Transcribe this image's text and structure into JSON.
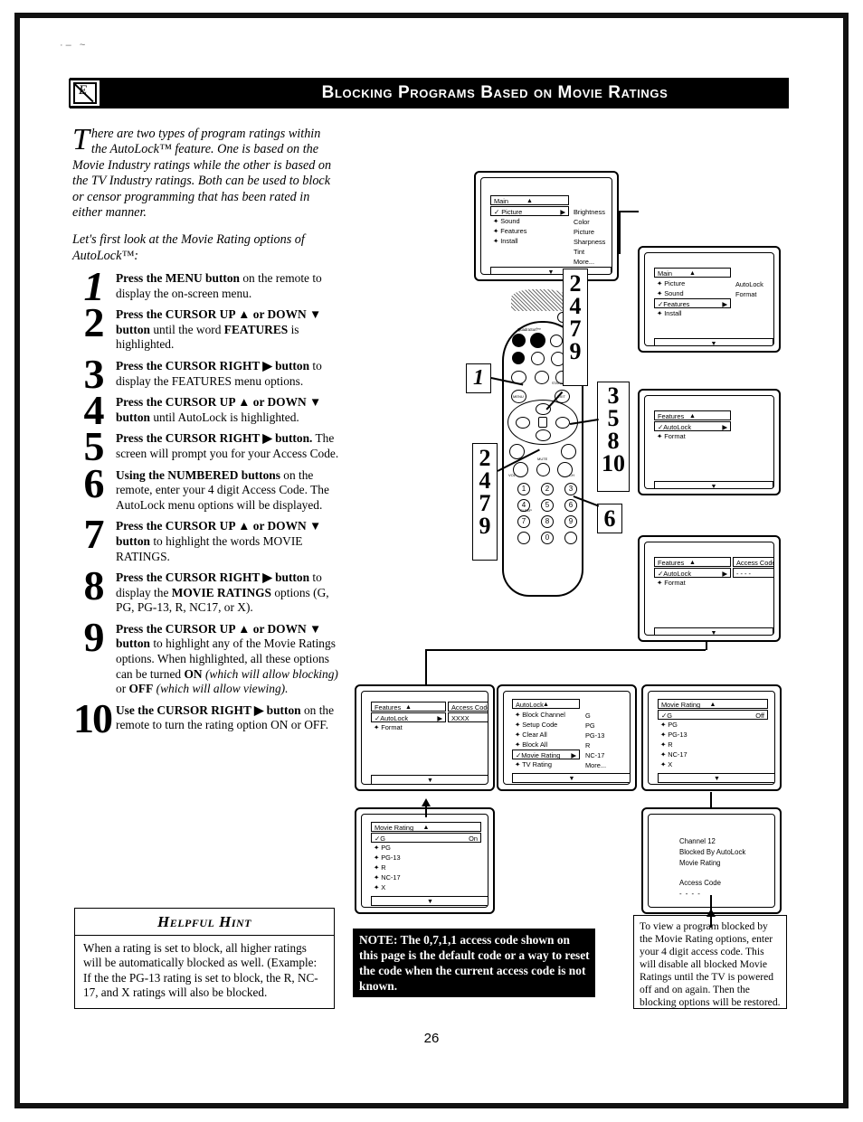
{
  "header": {
    "title": "Blocking Programs Based on Movie Ratings",
    "icon": "no-viewing-icon"
  },
  "intro": {
    "dropcap": "T",
    "paragraph1": "here are two types of program ratings within the AutoLock™ feature. One is based on the Movie Industry ratings while the other is based on the TV Industry ratings. Both can be used to block or censor programming that has been rated in either manner.",
    "paragraph2": "Let's first look at the Movie Rating options of AutoLock™:"
  },
  "steps": [
    {
      "num": "1",
      "html": "<b>Press the MENU button</b> on the remote to display the on-screen menu."
    },
    {
      "num": "2",
      "html": "<b>Press the CURSOR UP ▲ or DOWN ▼ button</b> until the word <b>FEATURES</b> is highlighted."
    },
    {
      "num": "3",
      "html": "<b>Press the CURSOR RIGHT ▶ button</b> to display the FEATURES menu options."
    },
    {
      "num": "4",
      "html": "<b>Press the CURSOR UP ▲ or DOWN ▼ button</b> until AutoLock is highlighted."
    },
    {
      "num": "5",
      "html": "<b>Press the CURSOR RIGHT ▶ button.</b> The screen will prompt you for your Access Code."
    },
    {
      "num": "6",
      "html": "<b>Using the NUMBERED buttons</b> on the remote, enter your 4 digit Access Code. The AutoLock menu options will be displayed."
    },
    {
      "num": "7",
      "html": "<b>Press the CURSOR UP ▲ or DOWN ▼ button</b> to highlight the words MOVIE RATINGS."
    },
    {
      "num": "8",
      "html": "<b>Press the CURSOR RIGHT ▶ button</b> to display the <b>MOVIE RATINGS</b> options (G, PG, PG-13, R, NC17, or X)."
    },
    {
      "num": "9",
      "html": "<b>Press the CURSOR UP ▲ or DOWN ▼ button</b> to highlight any of the Movie Ratings options. When highlighted, all these options can be turned <b>ON</b> <i>(which will allow blocking)</i> or <b>OFF</b> <i>(which will allow viewing).</i>"
    },
    {
      "num": "10",
      "html": "<b>Use the CURSOR RIGHT ▶ button</b> on the remote to turn the rating option ON or OFF."
    }
  ],
  "hint": {
    "title": "Helpful Hint",
    "body": "When a rating is set to block, all higher ratings will be automatically blocked as well. (Example: If the the PG-13 rating is set to block, the R, NC-17, and X ratings will also be blocked."
  },
  "page_number": "26",
  "note": {
    "text": "NOTE: The 0,7,1,1 access code shown on this page is the default code or a way to reset the code when the current access code is not known."
  },
  "info": {
    "text": "To view a program blocked by the Movie Rating options, enter your 4 digit access code. This will disable all blocked Movie Ratings until the TV is powered off and on again. Then the blocking options will be restored."
  },
  "tv_screens": {
    "screen1": {
      "title": "Main",
      "up_arrow": "▲",
      "down_arrow": "▼",
      "items": [
        {
          "label": "Picture",
          "bullet": "✓",
          "selected": true,
          "arrow": "▶"
        },
        {
          "label": "Sound",
          "bullet": "♦",
          "selected": false
        },
        {
          "label": "Features",
          "bullet": "♦",
          "selected": false
        },
        {
          "label": "Install",
          "bullet": "♦",
          "selected": false
        }
      ],
      "column2": [
        "Brightness",
        "Color",
        "Picture",
        "Sharpness",
        "Tint",
        "More..."
      ]
    },
    "screen2": {
      "title": "Main",
      "items": [
        {
          "label": "Picture",
          "bullet": "♦",
          "selected": false
        },
        {
          "label": "Sound",
          "bullet": "♦",
          "selected": false
        },
        {
          "label": "Features",
          "bullet": "✓",
          "selected": true,
          "arrow": "▶"
        },
        {
          "label": "Install",
          "bullet": "♦",
          "selected": false
        }
      ],
      "column2": [
        "AutoLock",
        "Format"
      ]
    },
    "screen3": {
      "title": "Features",
      "items": [
        {
          "label": "AutoLock",
          "bullet": "✓",
          "selected": true,
          "arrow": "▶"
        },
        {
          "label": "Format",
          "bullet": "♦",
          "selected": false
        }
      ],
      "column2": []
    },
    "screen4": {
      "title": "Features",
      "items": [
        {
          "label": "AutoLock",
          "bullet": "✓",
          "selected": true,
          "arrow": "▶"
        },
        {
          "label": "Format",
          "bullet": "♦",
          "selected": false
        }
      ],
      "subbox_label": "Access Code",
      "subbox_value": "- - - -"
    },
    "screen5": {
      "title": "Features",
      "items": [
        {
          "label": "AutoLock",
          "bullet": "✓",
          "selected": true,
          "arrow": "▶"
        },
        {
          "label": "Format",
          "bullet": "♦",
          "selected": false
        }
      ],
      "subbox_label": "Access Code",
      "subbox_value": "XXXX"
    },
    "screen6": {
      "title": "AutoLock",
      "items": [
        {
          "label": "Block Channel",
          "bullet": "♦",
          "selected": false
        },
        {
          "label": "Setup Code",
          "bullet": "♦",
          "selected": false
        },
        {
          "label": "Clear All",
          "bullet": "♦",
          "selected": false
        },
        {
          "label": "Block All",
          "bullet": "♦",
          "selected": false
        },
        {
          "label": "Movie Rating",
          "bullet": "✓",
          "selected": true,
          "arrow": "▶"
        },
        {
          "label": "TV Rating",
          "bullet": "♦",
          "selected": false
        }
      ],
      "column2": [
        "G",
        "PG",
        "PG-13",
        "R",
        "NC-17",
        "More..."
      ]
    },
    "screen7": {
      "title": "Movie Rating",
      "state_value": "Off",
      "items": [
        {
          "label": "G",
          "bullet": "✓",
          "selected": true
        },
        {
          "label": "PG",
          "bullet": "♦",
          "selected": false
        },
        {
          "label": "PG-13",
          "bullet": "♦",
          "selected": false
        },
        {
          "label": "R",
          "bullet": "♦",
          "selected": false
        },
        {
          "label": "NC-17",
          "bullet": "♦",
          "selected": false
        },
        {
          "label": "X",
          "bullet": "♦",
          "selected": false
        }
      ]
    },
    "screen8": {
      "title": "Movie Rating",
      "state_value": "On",
      "items": [
        {
          "label": "G",
          "bullet": "✓",
          "selected": true
        },
        {
          "label": "PG",
          "bullet": "♦",
          "selected": false
        },
        {
          "label": "PG-13",
          "bullet": "♦",
          "selected": false
        },
        {
          "label": "R",
          "bullet": "♦",
          "selected": false
        },
        {
          "label": "NC-17",
          "bullet": "♦",
          "selected": false
        },
        {
          "label": "X",
          "bullet": "♦",
          "selected": false
        }
      ]
    },
    "screen9": {
      "lines": [
        "Channel 12",
        "Blocked By AutoLock",
        "Movie Rating"
      ],
      "access_label": "Access Code",
      "access_value": "- - - -"
    }
  },
  "remote": {
    "brand": "QuadraSurf™",
    "buttons": {
      "menu": "MENU",
      "status": "STATUS",
      "exit": "EXIT",
      "cc": "CC",
      "surf": "SURF",
      "auto_pict": "AUTO PICT",
      "av": "AV",
      "a_ch": "A/CH",
      "pip": "PIP",
      "mute": "MUTE",
      "vol": "VOL",
      "ch": "CH",
      "sleep": "SLEEP"
    },
    "numbers": [
      "1",
      "2",
      "3",
      "4",
      "5",
      "6",
      "7",
      "8",
      "9",
      "0"
    ]
  },
  "callouts": [
    {
      "id": "callout-1",
      "numbers": [
        "1"
      ]
    },
    {
      "id": "callout-2479-top",
      "numbers": [
        "2",
        "4",
        "7",
        "9"
      ]
    },
    {
      "id": "callout-2479-bottom",
      "numbers": [
        "2",
        "4",
        "7",
        "9"
      ]
    },
    {
      "id": "callout-35810",
      "numbers": [
        "3",
        "5",
        "8",
        "10"
      ]
    },
    {
      "id": "callout-6",
      "numbers": [
        "6"
      ]
    }
  ]
}
